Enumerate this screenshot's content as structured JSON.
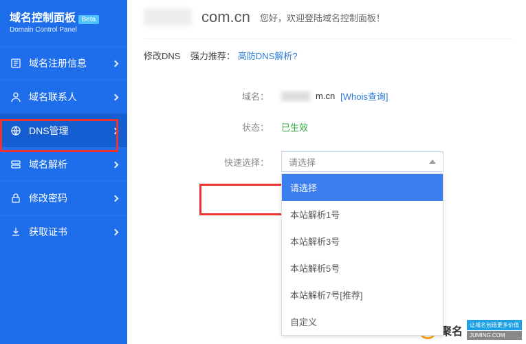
{
  "brand": {
    "title": "域名控制面板",
    "subtitle": "Domain Control Panel",
    "badge": "Beta"
  },
  "sidebar": {
    "items": [
      {
        "label": "域名注册信息"
      },
      {
        "label": "域名联系人"
      },
      {
        "label": "DNS管理"
      },
      {
        "label": "域名解析"
      },
      {
        "label": "修改密码"
      },
      {
        "label": "获取证书"
      }
    ]
  },
  "header": {
    "domain_suffix": "com.cn",
    "welcome": "您好，欢迎登陆域名控制面板！"
  },
  "breadcrumb": {
    "current": "修改DNS",
    "recommend_prefix": "强力推荐：",
    "recommend_link": "高防DNS解析?"
  },
  "form": {
    "domain_label": "域名：",
    "domain_value_suffix": "m.cn",
    "whois_link": "[Whois查询]",
    "status_label": "状态：",
    "status_value": "已生效",
    "select_label": "快速选择：",
    "select_placeholder": "请选择",
    "options": [
      "请选择",
      "本站解析1号",
      "本站解析3号",
      "本站解析5号",
      "本站解析7号[推荐]",
      "自定义"
    ]
  },
  "footer": {
    "brand": "聚名",
    "tagline": "让域名创造更多价值",
    "url": "JUMING.COM"
  }
}
